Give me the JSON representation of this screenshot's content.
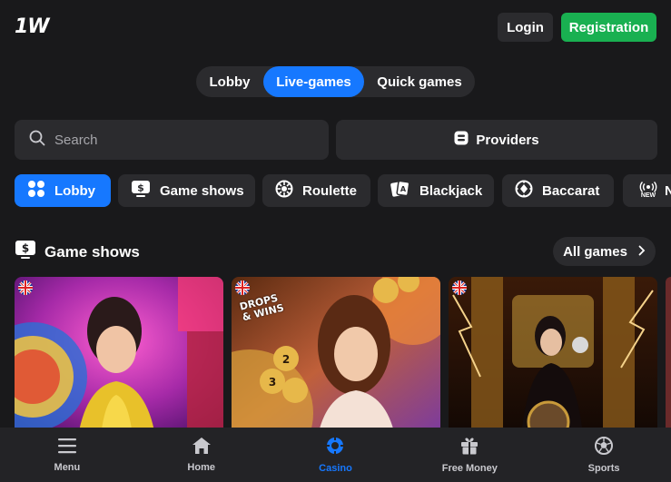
{
  "header": {
    "logo": "1W",
    "login_label": "Login",
    "registration_label": "Registration"
  },
  "tabs": [
    {
      "label": "Lobby"
    },
    {
      "label": "Live-games",
      "active": true
    },
    {
      "label": "Quick games"
    }
  ],
  "search": {
    "placeholder": "Search"
  },
  "providers_label": "Providers",
  "categories": [
    {
      "label": "Lobby",
      "icon": "grid-icon",
      "active": true
    },
    {
      "label": "Game shows",
      "icon": "dollar-icon"
    },
    {
      "label": "Roulette",
      "icon": "roulette-icon"
    },
    {
      "label": "Blackjack",
      "icon": "cards-icon"
    },
    {
      "label": "Baccarat",
      "icon": "chip-icon"
    },
    {
      "label": "N",
      "badge": "NEW",
      "icon": "broadcast-icon"
    }
  ],
  "section": {
    "title": "Game shows",
    "all_games_label": "All games"
  },
  "game_cards": [
    {
      "flag": "uk-flag"
    },
    {
      "flag": "uk-flag",
      "overlay_text": [
        "DROPS",
        "& WINS"
      ]
    },
    {
      "flag": "uk-flag"
    }
  ],
  "bottom_nav": [
    {
      "label": "Menu",
      "icon": "menu-icon"
    },
    {
      "label": "Home",
      "icon": "home-icon"
    },
    {
      "label": "Casino",
      "icon": "casino-icon",
      "active": true
    },
    {
      "label": "Free Money",
      "icon": "gift-icon"
    },
    {
      "label": "Sports",
      "icon": "soccer-ball-icon"
    }
  ],
  "colors": {
    "background": "#19191b",
    "surface": "#2b2b2e",
    "accent": "#1678ff",
    "registration": "#19b051"
  }
}
